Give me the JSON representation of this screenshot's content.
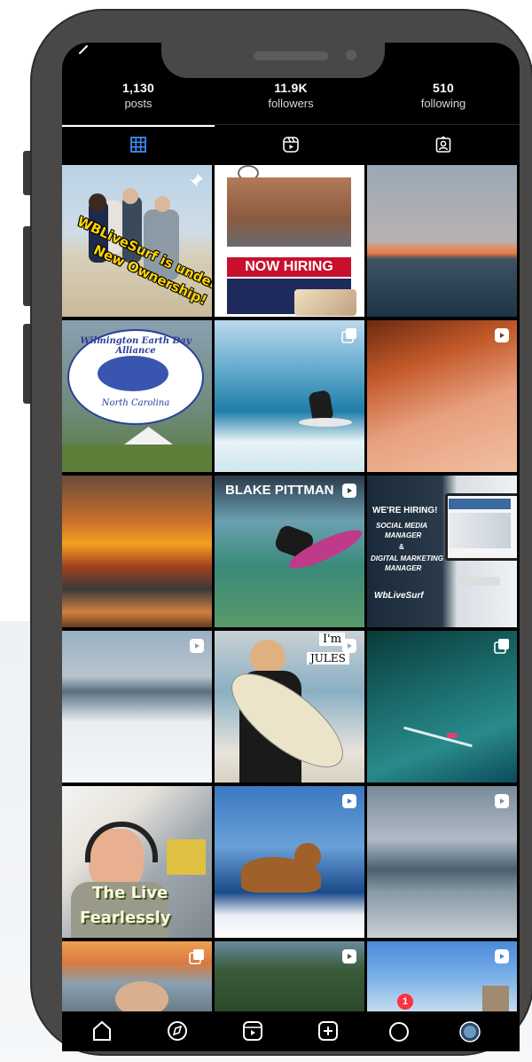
{
  "profile": {
    "stats": [
      {
        "value": "1,130",
        "label": "posts"
      },
      {
        "value": "11.9K",
        "label": "followers"
      },
      {
        "value": "510",
        "label": "following"
      }
    ]
  },
  "tabs": [
    {
      "name": "grid",
      "icon": "grid-icon",
      "active": true
    },
    {
      "name": "reels",
      "icon": "reels-icon",
      "active": false
    },
    {
      "name": "tagged",
      "icon": "tagged-icon",
      "active": false
    }
  ],
  "posts": [
    {
      "caption_main": "WBLiveSurf is under",
      "caption_sub": "New Ownership!",
      "icon": "pin-icon"
    },
    {
      "headline": "NOW HIRING"
    },
    {},
    {
      "title": "Wilmington Earth Day Alliance",
      "subtitle": "North Carolina"
    },
    {
      "icon": "carousel-icon"
    },
    {
      "icon": "reels-icon"
    },
    {},
    {
      "text": "BLAKE PITTMAN",
      "icon": "reels-icon"
    },
    {
      "line1": "WE'RE HIRING!",
      "line2": "SOCIAL MEDIA",
      "line3": "MANAGER",
      "line4": "&",
      "line5": "DIGITAL MARKETING",
      "line6": "MANAGER",
      "brand": "WbLiveSurf"
    },
    {
      "icon": "reels-icon"
    },
    {
      "tag1": "I'm",
      "tag2": "JULES",
      "icon": "reels-icon"
    },
    {
      "icon": "carousel-icon"
    },
    {
      "line1": "The Live",
      "line2": "Fearlessly"
    },
    {
      "icon": "reels-icon"
    },
    {
      "icon": "reels-icon"
    },
    {
      "icon": "carousel-icon"
    },
    {
      "icon": "reels-icon"
    },
    {
      "icon": "reels-icon"
    }
  ],
  "bottom_nav": {
    "items": [
      "home-icon",
      "explore-icon",
      "reels-icon",
      "create-icon",
      "activity-icon",
      "profile-avatar"
    ],
    "badge": "1"
  },
  "colors": {
    "accent_red": "#ff3040",
    "hiring_red": "#c8102e",
    "phone_frame": "#4a4847"
  }
}
